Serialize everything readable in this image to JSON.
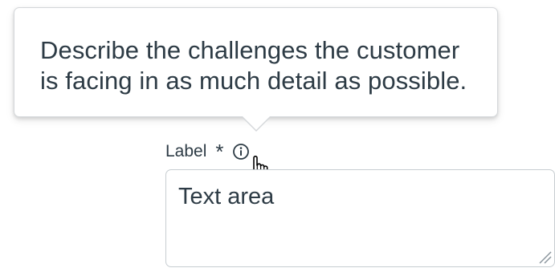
{
  "tooltip": {
    "text": "Describe the challenges the customer is facing in as much detail as possible."
  },
  "field": {
    "label": "Label",
    "required_symbol": "*",
    "placeholder": "Text area"
  },
  "icons": {
    "info": "info-circle-icon",
    "cursor": "pointer-hand-icon",
    "resize": "resize-grip-icon"
  },
  "colors": {
    "text": "#2d3b45",
    "border": "#c7cdd1",
    "tooltip_border": "#d4d7da"
  }
}
